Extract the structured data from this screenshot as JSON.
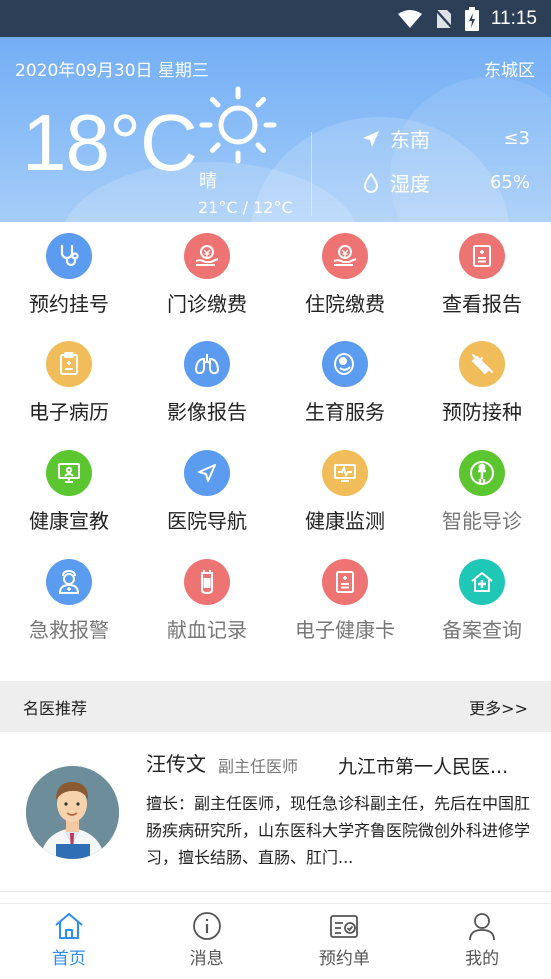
{
  "status_bar": {
    "time": "11:15"
  },
  "weather": {
    "date": "2020年09月30日 星期三",
    "district": "东城区",
    "temperature": "18°C",
    "condition": "晴",
    "range": "21°C / 12°C",
    "wind_direction": "东南",
    "wind_level": "≤3",
    "humidity_label": "湿度",
    "humidity_value": "65%",
    "icon": "sun-icon"
  },
  "services": [
    {
      "label": "预约挂号",
      "icon": "stethoscope-icon",
      "color": "#5b9bf0"
    },
    {
      "label": "门诊缴费",
      "icon": "payment-hand-icon",
      "color": "#ee7373"
    },
    {
      "label": "住院缴费",
      "icon": "payment-hand-icon",
      "color": "#ee7373"
    },
    {
      "label": "查看报告",
      "icon": "report-icon",
      "color": "#ee7373"
    },
    {
      "label": "电子病历",
      "icon": "clipboard-icon",
      "color": "#f0bd5a"
    },
    {
      "label": "影像报告",
      "icon": "lungs-icon",
      "color": "#5b9bf0"
    },
    {
      "label": "生育服务",
      "icon": "baby-icon",
      "color": "#5b9bf0"
    },
    {
      "label": "预防接种",
      "icon": "syringe-icon",
      "color": "#f0bd5a"
    },
    {
      "label": "健康宣教",
      "icon": "monitor-icon",
      "color": "#5cc630"
    },
    {
      "label": "医院导航",
      "icon": "navigation-icon",
      "color": "#5b9bf0"
    },
    {
      "label": "健康监测",
      "icon": "heartbeat-monitor-icon",
      "color": "#f0bd5a"
    },
    {
      "label": "智能导诊",
      "icon": "person-guide-icon",
      "color": "#5cc630"
    },
    {
      "label": "急救报警",
      "icon": "doctor-icon",
      "color": "#5b9bf0"
    },
    {
      "label": "献血记录",
      "icon": "blood-bag-icon",
      "color": "#ee7373"
    },
    {
      "label": "电子健康卡",
      "icon": "health-card-icon",
      "color": "#ee7373"
    },
    {
      "label": "备案查询",
      "icon": "hospital-icon",
      "color": "#1fc7b7"
    }
  ],
  "famous_doctors": {
    "title": "名医推荐",
    "more": "更多>>",
    "doctor": {
      "name": "汪传文",
      "title": "副主任医师",
      "hospital": "九江市第一人民医...",
      "description": "擅长：副主任医师，现任急诊科副主任，先后在中国肛肠疾病研究所，山东医科大学齐鲁医院微创外科进修学习，擅长结肠、直肠、肛门..."
    }
  },
  "tab_bar": {
    "tabs": [
      {
        "label": "首页",
        "icon": "home-icon",
        "active": true
      },
      {
        "label": "消息",
        "icon": "info-icon",
        "active": false
      },
      {
        "label": "预约单",
        "icon": "appointment-icon",
        "active": false
      },
      {
        "label": "我的",
        "icon": "user-icon",
        "active": false
      }
    ],
    "active_color": "#2f8ff0"
  }
}
